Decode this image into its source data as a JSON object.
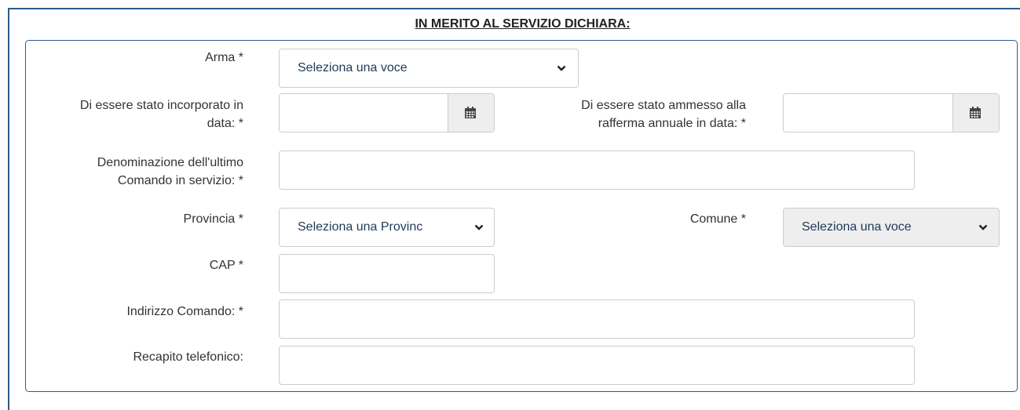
{
  "section_title": "IN MERITO AL SERVIZIO DICHIARA:",
  "fields": {
    "arma": {
      "label": "Arma *",
      "selected": "Seleziona una voce"
    },
    "incorporato": {
      "label_line1": "Di essere stato incorporato in",
      "label_line2": "data: *",
      "value": ""
    },
    "rafferma": {
      "label_line1": "Di essere stato ammesso alla",
      "label_line2": "rafferma annuale in data: *",
      "value": ""
    },
    "denominazione": {
      "label_line1": "Denominazione dell'ultimo",
      "label_line2": "Comando in servizio: *",
      "value": ""
    },
    "provincia": {
      "label": "Provincia *",
      "selected": "Seleziona una Provinc"
    },
    "comune": {
      "label": "Comune *",
      "selected": "Seleziona una voce"
    },
    "cap": {
      "label": "CAP *",
      "value": ""
    },
    "indirizzo": {
      "label": "Indirizzo Comando: *",
      "value": ""
    },
    "recapito": {
      "label": "Recapito telefonico:",
      "value": ""
    }
  },
  "icons": {
    "calendar": "calendar-icon",
    "chevron": "chevron-down-icon"
  },
  "colors": {
    "border_accent": "#2c5b8a",
    "select_text": "#1f3a5a",
    "disabled_bg": "#eeeeee"
  }
}
